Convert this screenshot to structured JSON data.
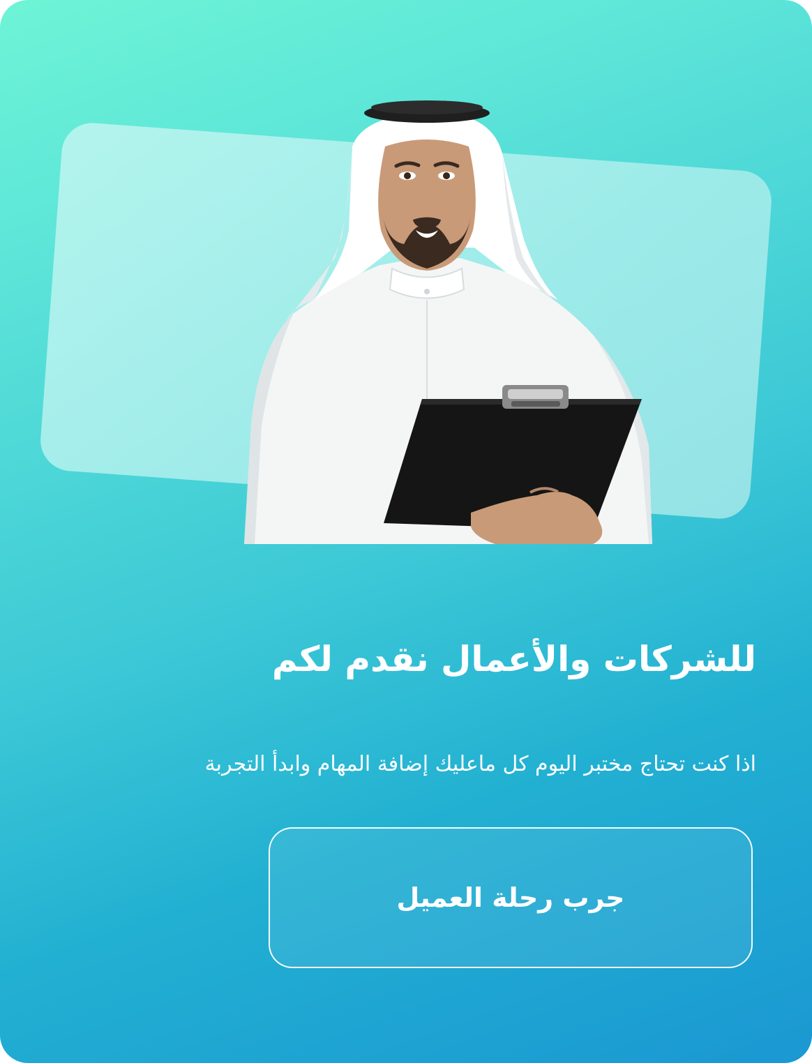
{
  "hero": {
    "image_subject": "man-in-white-thobe-holding-clipboard"
  },
  "content": {
    "headline": "للشركات والأعمال نقدم لكم",
    "description": "اذا كنت تحتاج مختبر اليوم كل ماعليك إضافة المهام وابدأ التجربة"
  },
  "cta": {
    "label": "جرب رحلة العميل"
  },
  "colors": {
    "gradient_top": "#6ef4d6",
    "gradient_bottom": "#1a98d2",
    "text": "#ffffff"
  }
}
